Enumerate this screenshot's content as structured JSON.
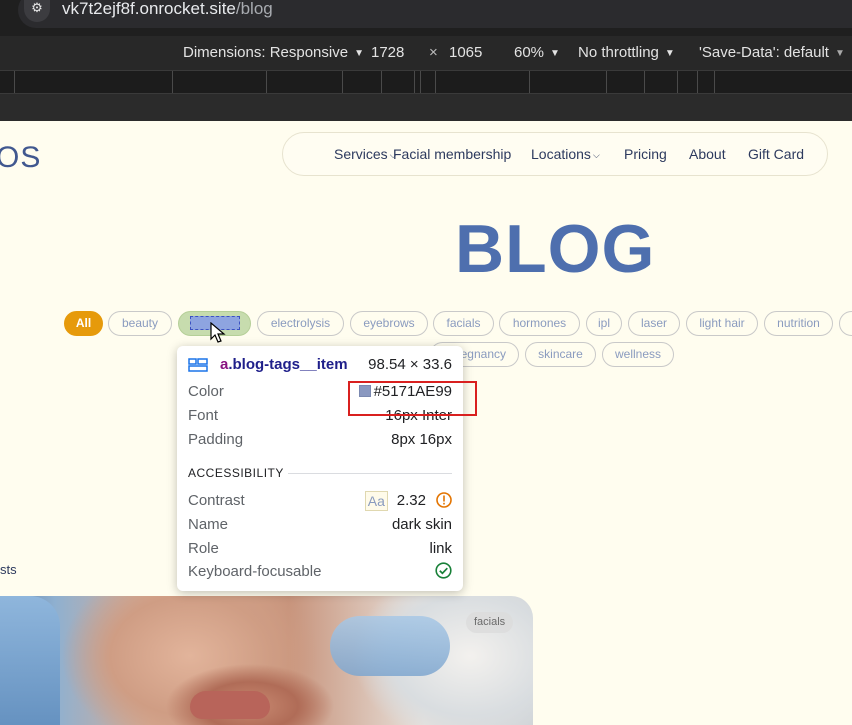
{
  "browser": {
    "url_host": "vk7t2ejf8f.onrocket.site",
    "url_path": "/blog",
    "tune_icon": "tune-icon"
  },
  "device_toolbar": {
    "dimensions_label": "Dimensions: Responsive",
    "width": "1728",
    "times": "×",
    "height": "1065",
    "zoom": "60%",
    "throttling": "No throttling",
    "save_data": "'Save-Data': default"
  },
  "site": {
    "logo_fragment": "OS",
    "nav": [
      {
        "label": "Services",
        "has_dropdown": true
      },
      {
        "label": "Facial membership",
        "has_dropdown": false
      },
      {
        "label": "Locations",
        "has_dropdown": true
      },
      {
        "label": "Pricing",
        "has_dropdown": false
      },
      {
        "label": "About",
        "has_dropdown": false
      },
      {
        "label": "Gift Card",
        "has_dropdown": false
      }
    ],
    "chevron": "⌵",
    "title": "BLOG",
    "tags_row1": [
      "All",
      "beauty",
      "electrolysis",
      "eyebrows",
      "facials",
      "hormones",
      "ipl",
      "laser",
      "light hair",
      "nutrition"
    ],
    "tags_row2": [
      "egnancy",
      "skincare",
      "wellness"
    ],
    "posts_fragment": "sts",
    "photo_badge": "facials"
  },
  "tooltip": {
    "selector_tag": "a",
    "selector_class": ".blog-tags__item",
    "size": "98.54 × 33.6",
    "color_label": "Color",
    "color_value": "#5171AE99",
    "color_hex": "#5171AE",
    "font_label": "Font",
    "font_value": "16px Inter",
    "padding_label": "Padding",
    "padding_value": "8px 16px",
    "accessibility_heading": "ACCESSIBILITY",
    "contrast_label": "Contrast",
    "contrast_sample": "Aa",
    "contrast_value": "2.32",
    "name_label": "Name",
    "name_value": "dark skin",
    "role_label": "Role",
    "role_value": "link",
    "keyboard_label": "Keyboard-focusable"
  },
  "colors": {
    "page_bg": "#fffdef",
    "accent_orange": "#e69a0b",
    "title_blue": "#4e6fae",
    "highlight_red": "#d9201f"
  }
}
